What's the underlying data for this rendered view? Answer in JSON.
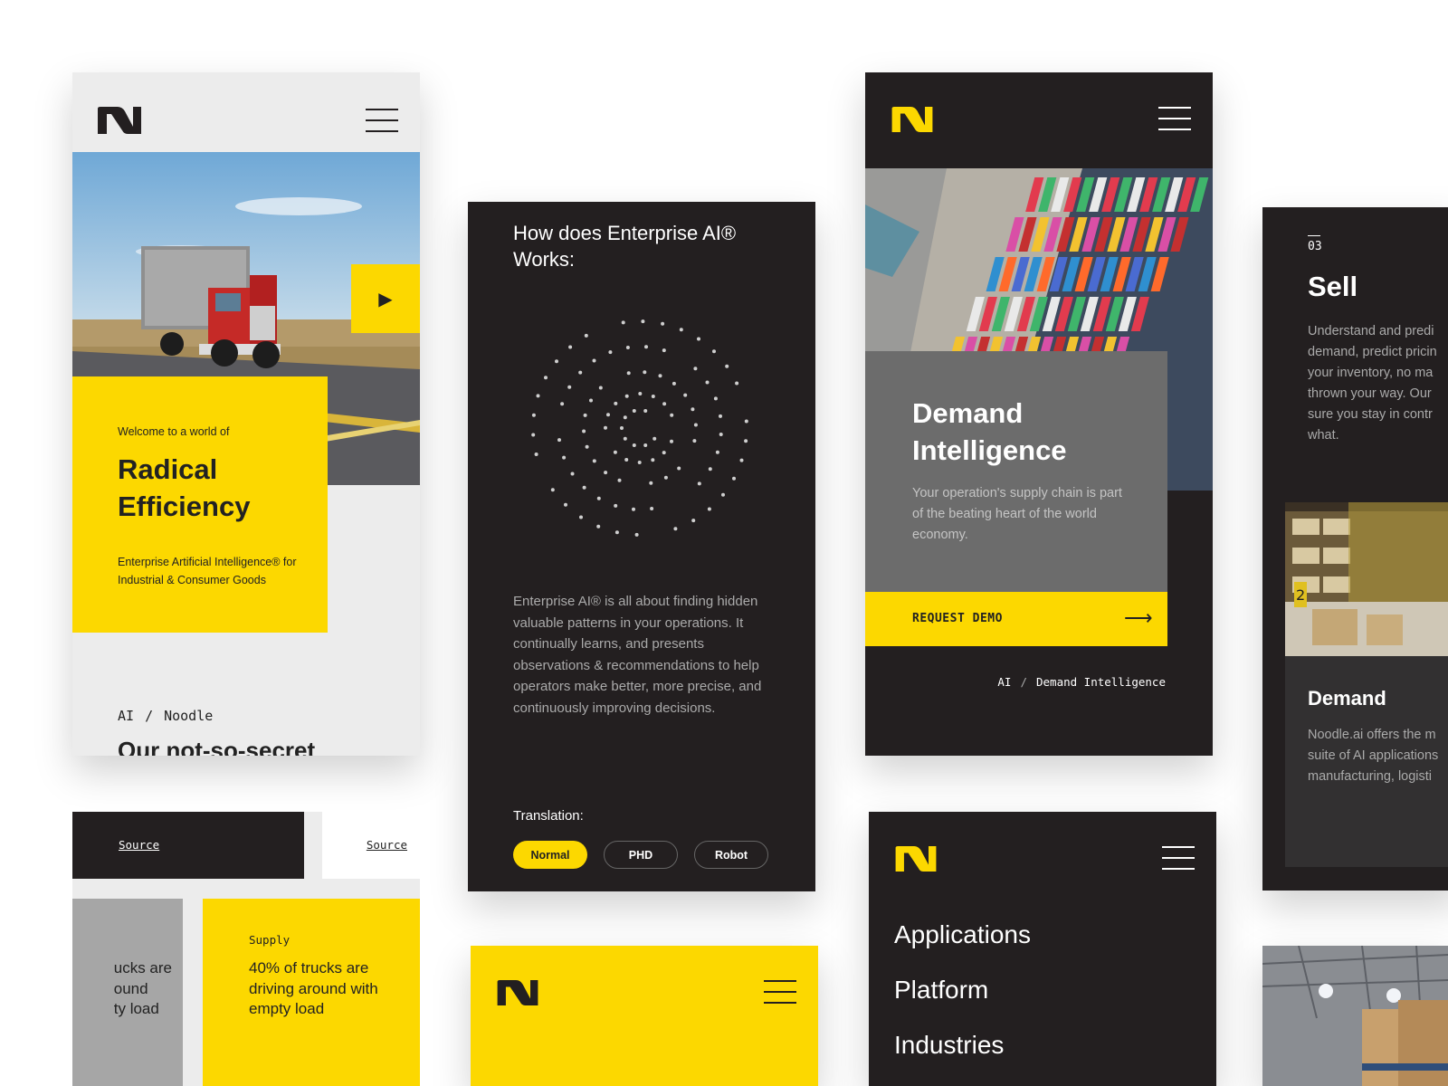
{
  "colors": {
    "accent": "#fcd800",
    "dark": "#231f20",
    "light": "#ececec",
    "grey": "#6c6c6c"
  },
  "hero_card": {
    "logo": "N",
    "menu_icon": "hamburger-icon",
    "play_icon": "play-icon",
    "eyebrow": "Welcome to a world of",
    "headline": "Radical Efficiency",
    "subcopy": "Enterprise Artificial Intelligence® for Industrial & Consumer Goods",
    "breadcrumb": {
      "first": "AI",
      "separator": "/",
      "second": "Noodle"
    },
    "teaser": "Our not-so-secret"
  },
  "how_card": {
    "title": "How does Enterprise AI® Works:",
    "body": "Enterprise AI® is all about finding hidden valuable patterns in your operations. It continually learns, and presents observations & recommendations to help operators make better, more precise, and continuously improving decisions.",
    "translation_label": "Translation:",
    "options": [
      "Normal",
      "PHD",
      "Robot"
    ],
    "selected": "Normal"
  },
  "demand_card": {
    "logo": "N",
    "heading": "Demand Intelligence",
    "body": "Your operation's supply chain is part of the beating heart of the world economy.",
    "cta": "REQUEST DEMO",
    "breadcrumb": {
      "first": "AI",
      "separator": "/",
      "second": "Demand Intelligence"
    }
  },
  "sell_card": {
    "number": "03",
    "heading": "Sell",
    "body_lines": [
      "Understand and predi",
      "demand, predict pricin",
      "your inventory, no ma",
      "thrown your way. Our",
      "sure you stay in contr",
      "what."
    ],
    "subheading": "Demand",
    "sub_body_lines": [
      "Noodle.ai offers the m",
      "suite of AI applications",
      "manufacturing, logisti"
    ]
  },
  "stats_card": {
    "source_left": "Source",
    "source_right": "Source",
    "grey_text_lines": [
      "ucks are",
      "ound",
      "ty load"
    ],
    "supply_label": "Supply",
    "supply_text": "40% of trucks are driving around with empty load"
  },
  "menu_card": {
    "logo": "N",
    "items": [
      "Applications",
      "Platform",
      "Industries"
    ]
  }
}
